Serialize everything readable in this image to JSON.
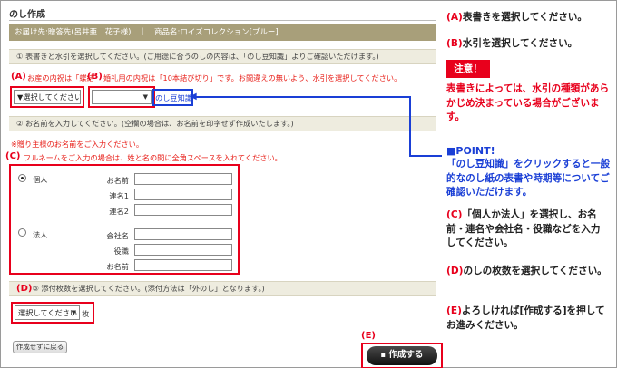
{
  "page_title": "のし作成",
  "destination_bar": "お届け先:贈答先(呂井亜　花子様)　｜　商品名:ロイズコレクション[ブルー]",
  "section1": {
    "heading": "① 表書きと水引を選択してください。(ご用途に合うのしの内容は、「のし豆知識」よりご確認いただけます。)",
    "note_a_mark": "(A)",
    "note_a": "お産の内祝は「蝶結",
    "note_b_mark": "(B)",
    "note_b": "婚礼用の内祝は「10本結び切り」です。お間違えの無いよう、水引を選択してください。",
    "omote_select": "▼選択してください",
    "mizuhiki_select": "",
    "noshi_link": "のし豆知識"
  },
  "section2": {
    "heading": "② お名前を入力してください。(空欄の場合は、お名前を印字せず作成いたします。)",
    "note1": "※贈り主様のお名前をご入力ください。",
    "note2_mark": "(C)",
    "note2": "フルネームをご入力の場合は、姓と名の間に全角スペースを入れてください。",
    "individual": {
      "option_label": "個人",
      "fields": [
        "お名前",
        "連名1",
        "連名2"
      ]
    },
    "corporate": {
      "option_label": "法人",
      "fields": [
        "会社名",
        "役職",
        "お名前"
      ]
    }
  },
  "section3": {
    "mark": "(D)",
    "heading": "③ 添付枚数を選択してください。(添付方法は「外のし」となります。)",
    "count_select": "選択してください",
    "unit": "枚"
  },
  "back_button": "作成せずに戻る",
  "create_mark": "(E)",
  "create_button": "作成する",
  "instructions": {
    "a_mark": "(A)",
    "a_text": "表書きを選択してください。",
    "b_mark": "(B)",
    "b_text": "水引を選択してください。",
    "warning_badge": "注意！",
    "warning_text": "表書きによっては、水引の種類があらかじめ決まっている場合がございます。",
    "point_title": "■POINT!",
    "point_text": "「のし豆知識」をクリックすると一般的なのし紙の表書や時期等についてご確認いただけます。",
    "c_mark": "(C)",
    "c_text": "「個人か法人」を選択し、お名前・連名や会社名・役職などを入力してください。",
    "d_mark": "(D)",
    "d_text": "のしの枚数を選択してください。",
    "e_mark": "(E)",
    "e_text": "よろしければ[作成する]を押してお進みください。"
  },
  "colors": {
    "accent_red": "#e8001c",
    "accent_blue": "#1a3fd6",
    "bar_bg": "#a89f7a",
    "section_bg": "#eeecdf"
  }
}
